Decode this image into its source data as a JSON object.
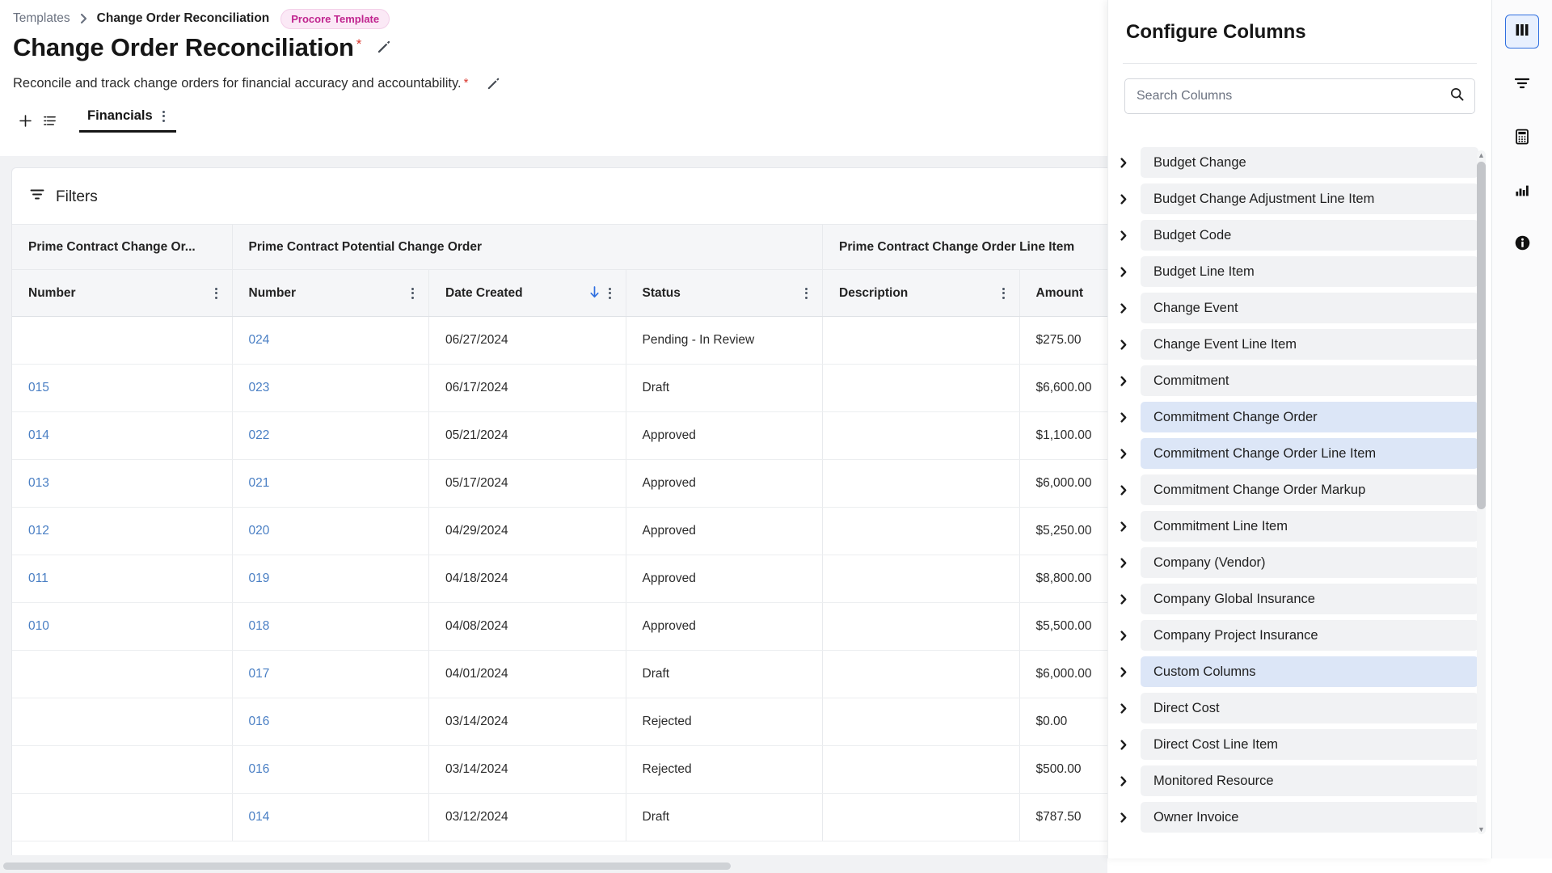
{
  "breadcrumb": {
    "root": "Templates",
    "current": "Change Order Reconciliation",
    "badge": "Procore Template"
  },
  "header": {
    "title": "Change Order Reconciliation",
    "subtitle": "Reconcile and track change orders for financial accuracy and accountability.",
    "required_marker": "*"
  },
  "tabs": {
    "add_label": "+",
    "list_label": "list-icon",
    "items": [
      {
        "label": "Financials",
        "active": true
      }
    ]
  },
  "toolbar": {
    "filters_label": "Filters"
  },
  "table": {
    "groups": [
      {
        "label": "Prime Contract Change Or...",
        "span": 1
      },
      {
        "label": "Prime Contract Potential Change Order",
        "span": 3
      },
      {
        "label": "Prime Contract Change Order Line Item",
        "span": 2
      }
    ],
    "columns": [
      {
        "label": "Number",
        "sorted": false,
        "menu": true
      },
      {
        "label": "Number",
        "sorted": false,
        "menu": true
      },
      {
        "label": "Date Created",
        "sorted": true,
        "sort_dir": "desc",
        "menu": true
      },
      {
        "label": "Status",
        "sorted": false,
        "menu": true
      },
      {
        "label": "Description",
        "sorted": false,
        "menu": true
      },
      {
        "label": "Amount",
        "sorted": false,
        "menu": false
      }
    ],
    "rows": [
      {
        "pcco_number": "",
        "pcpco_number": "024",
        "date_created": "06/27/2024",
        "status": "Pending - In Review",
        "description": "",
        "amount": "$275.00"
      },
      {
        "pcco_number": "015",
        "pcpco_number": "023",
        "date_created": "06/17/2024",
        "status": "Draft",
        "description": "",
        "amount": "$6,600.00"
      },
      {
        "pcco_number": "014",
        "pcpco_number": "022",
        "date_created": "05/21/2024",
        "status": "Approved",
        "description": "",
        "amount": "$1,100.00"
      },
      {
        "pcco_number": "013",
        "pcpco_number": "021",
        "date_created": "05/17/2024",
        "status": "Approved",
        "description": "",
        "amount": "$6,000.00"
      },
      {
        "pcco_number": "012",
        "pcpco_number": "020",
        "date_created": "04/29/2024",
        "status": "Approved",
        "description": "",
        "amount": "$5,250.00"
      },
      {
        "pcco_number": "011",
        "pcpco_number": "019",
        "date_created": "04/18/2024",
        "status": "Approved",
        "description": "",
        "amount": "$8,800.00"
      },
      {
        "pcco_number": "010",
        "pcpco_number": "018",
        "date_created": "04/08/2024",
        "status": "Approved",
        "description": "",
        "amount": "$5,500.00"
      },
      {
        "pcco_number": "",
        "pcpco_number": "017",
        "date_created": "04/01/2024",
        "status": "Draft",
        "description": "",
        "amount": "$6,000.00"
      },
      {
        "pcco_number": "",
        "pcpco_number": "016",
        "date_created": "03/14/2024",
        "status": "Rejected",
        "description": "",
        "amount": "$0.00"
      },
      {
        "pcco_number": "",
        "pcpco_number": "016",
        "date_created": "03/14/2024",
        "status": "Rejected",
        "description": "",
        "amount": "$500.00"
      },
      {
        "pcco_number": "",
        "pcpco_number": "014",
        "date_created": "03/12/2024",
        "status": "Draft",
        "description": "",
        "amount": "$787.50"
      }
    ]
  },
  "panel": {
    "title": "Configure Columns",
    "search": {
      "placeholder": "Search Columns",
      "value": ""
    },
    "items": [
      {
        "label": "Budget Change",
        "selected": false
      },
      {
        "label": "Budget Change Adjustment Line Item",
        "selected": false
      },
      {
        "label": "Budget Code",
        "selected": false
      },
      {
        "label": "Budget Line Item",
        "selected": false
      },
      {
        "label": "Change Event",
        "selected": false
      },
      {
        "label": "Change Event Line Item",
        "selected": false
      },
      {
        "label": "Commitment",
        "selected": false
      },
      {
        "label": "Commitment Change Order",
        "selected": true
      },
      {
        "label": "Commitment Change Order Line Item",
        "selected": true
      },
      {
        "label": "Commitment Change Order Markup",
        "selected": false
      },
      {
        "label": "Commitment Line Item",
        "selected": false
      },
      {
        "label": "Company (Vendor)",
        "selected": false
      },
      {
        "label": "Company Global Insurance",
        "selected": false
      },
      {
        "label": "Company Project Insurance",
        "selected": false
      },
      {
        "label": "Custom Columns",
        "selected": true
      },
      {
        "label": "Direct Cost",
        "selected": false
      },
      {
        "label": "Direct Cost Line Item",
        "selected": false
      },
      {
        "label": "Monitored Resource",
        "selected": false
      },
      {
        "label": "Owner Invoice",
        "selected": false
      }
    ]
  },
  "rail": {
    "items": [
      {
        "icon": "columns-icon",
        "name": "configure-columns",
        "active": true
      },
      {
        "icon": "filter-icon",
        "name": "filters",
        "active": false
      },
      {
        "icon": "calculator-icon",
        "name": "calculations",
        "active": false
      },
      {
        "icon": "bar-chart-icon",
        "name": "charts",
        "active": false
      },
      {
        "icon": "info-icon",
        "name": "info",
        "active": false
      }
    ]
  },
  "colors": {
    "accent_blue": "#2f6fe0",
    "link_blue": "#4a7fc4",
    "badge_pink": "#c0258f",
    "required_red": "#d8342b",
    "selected_row": "#dce6f7",
    "pill_gray": "#f1f2f4"
  }
}
